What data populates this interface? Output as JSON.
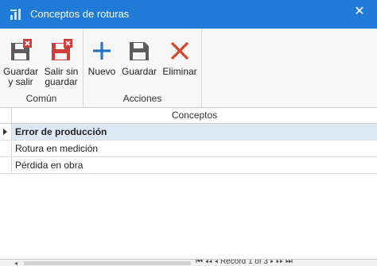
{
  "window": {
    "title": "Conceptos de roturas",
    "close_glyph": "✕"
  },
  "ribbon": {
    "groups": [
      {
        "label": "Común",
        "buttons": [
          {
            "label_line1": "Guardar",
            "label_line2": "y salir",
            "icon": "save-close-icon"
          },
          {
            "label_line1": "Salir sin",
            "label_line2": "guardar",
            "icon": "exit-no-save-icon"
          }
        ]
      },
      {
        "label": "Acciones",
        "buttons": [
          {
            "label_line1": "Nuevo",
            "icon": "plus-icon"
          },
          {
            "label_line1": "Guardar",
            "icon": "save-icon"
          },
          {
            "label_line1": "Eliminar",
            "icon": "delete-icon"
          }
        ]
      }
    ]
  },
  "grid": {
    "column_header": "Conceptos",
    "rows": [
      {
        "value": "Error de producción",
        "selected": true
      },
      {
        "value": "Rotura en medición",
        "selected": false
      },
      {
        "value": "Pérdida en obra",
        "selected": false
      }
    ]
  },
  "navigator": {
    "record_text": "Record 1 of 3"
  },
  "colors": {
    "titlebar": "#1f7bd6",
    "save_icon": "#5c5c5c",
    "red_icon": "#d33a3a",
    "plus_icon": "#2a75c6",
    "delete_icon": "#d9462c",
    "selected_row": "#dde9f7"
  }
}
